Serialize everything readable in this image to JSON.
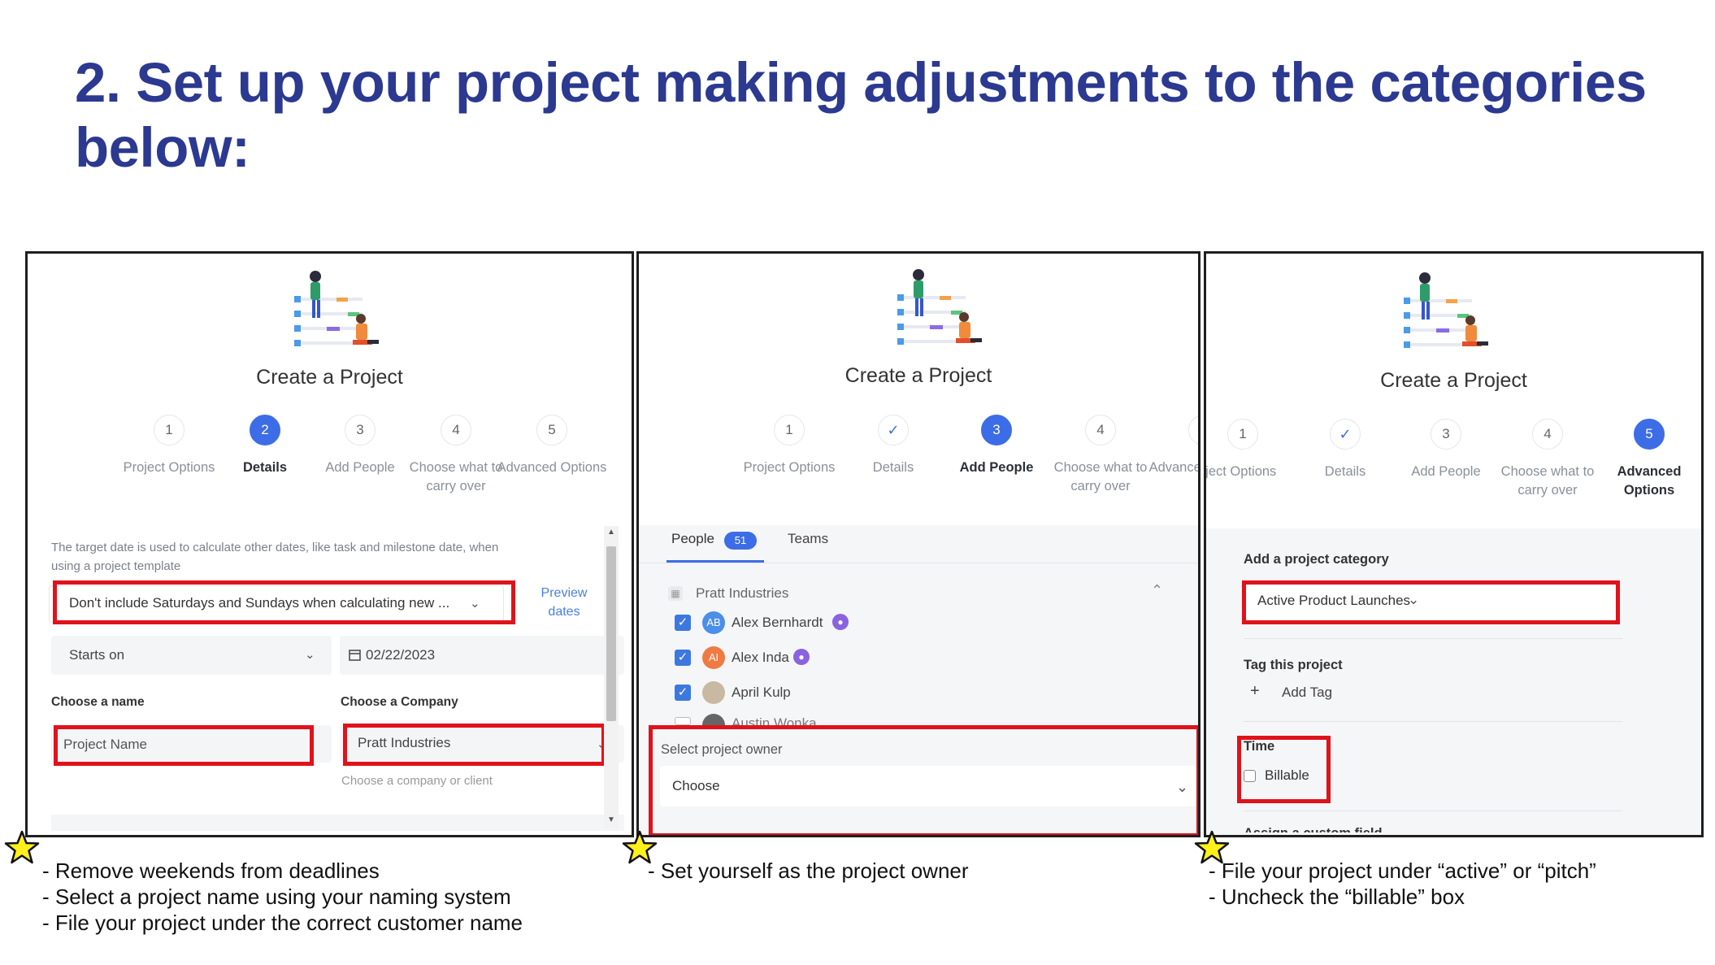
{
  "heading": "2. Set up your project making adjustments to the categories below:",
  "colors": {
    "heading": "#2b3990",
    "highlight": "#e0121b",
    "active_step": "#3d6de6"
  },
  "panel1": {
    "title": "Create a Project",
    "steps": [
      {
        "num": "1",
        "label": "Project Options"
      },
      {
        "num": "2",
        "label": "Details"
      },
      {
        "num": "3",
        "label": "Add People"
      },
      {
        "num": "4",
        "label": "Choose what to carry over"
      },
      {
        "num": "5",
        "label": "Advanced Options"
      }
    ],
    "info_text": "The target date is used to calculate other dates, like task and milestone date, when using a project template",
    "weekend_select": "Don't include Saturdays and Sundays when calculating new ...",
    "preview_link": "Preview dates",
    "starts_on": "Starts on",
    "date_value": "02/22/2023",
    "name_label": "Choose a name",
    "name_placeholder": "Project Name",
    "company_label": "Choose a Company",
    "company_value": "Pratt Industries",
    "company_hint": "Choose a company or client"
  },
  "panel2": {
    "title": "Create a Project",
    "steps": [
      {
        "num": "1",
        "label": "Project Options"
      },
      {
        "num": "✓",
        "label": "Details"
      },
      {
        "num": "3",
        "label": "Add People"
      },
      {
        "num": "4",
        "label": "Choose what to carry over"
      },
      {
        "num": "5",
        "label": "Advanced Options"
      }
    ],
    "tab_people": "People",
    "people_count": "51",
    "tab_teams": "Teams",
    "group_name": "Pratt Industries",
    "people": [
      {
        "initials": "AB",
        "name": "Alex Bernhardt"
      },
      {
        "initials": "AI",
        "name": "Alex Inda"
      },
      {
        "initials": "",
        "name": "April Kulp"
      },
      {
        "initials": "",
        "name": "Austin Wonka"
      }
    ],
    "owner_label": "Select project owner",
    "owner_value": "Choose"
  },
  "panel3": {
    "title": "Create a Project",
    "steps": [
      {
        "num": "1",
        "label": "oject Options"
      },
      {
        "num": "✓",
        "label": "Details"
      },
      {
        "num": "3",
        "label": "Add People"
      },
      {
        "num": "4",
        "label": "Choose what to carry over"
      },
      {
        "num": "5",
        "label": "Advanced Options"
      }
    ],
    "category_label": "Add a project category",
    "category_value": "Active Product Launches",
    "tag_label": "Tag this project",
    "add_tag": "Add Tag",
    "time_label": "Time",
    "billable": "Billable",
    "custom_field": "Assign a custom field"
  },
  "notes": {
    "col1": [
      "- Remove weekends from deadlines",
      "- Select a project name using your naming system",
      "- File your project under the correct customer name"
    ],
    "col2": [
      "- Set yourself as the project owner"
    ],
    "col3": [
      "- File your project under “active” or “pitch”",
      "- Uncheck the “billable” box"
    ]
  }
}
